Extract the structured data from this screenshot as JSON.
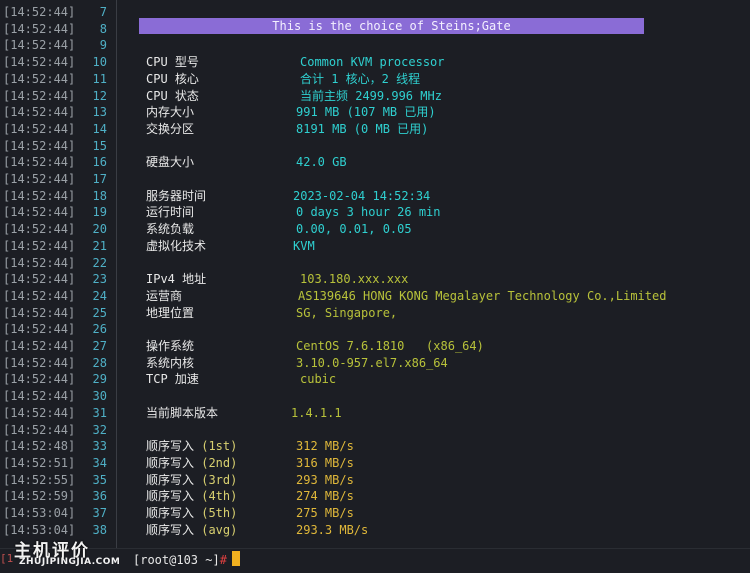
{
  "banner": "This is the choice of Steins;Gate",
  "rows": [
    {
      "ts": "[14:52:44]",
      "ln": "7",
      "label": "",
      "value": "",
      "color": ""
    },
    {
      "ts": "[14:52:44]",
      "ln": "8",
      "label": "",
      "value": "",
      "color": ""
    },
    {
      "ts": "[14:52:44]",
      "ln": "9",
      "label": "",
      "value": "",
      "color": ""
    },
    {
      "ts": "[14:52:44]",
      "ln": "10",
      "label": "CPU 型号",
      "value": "Common KVM processor",
      "color": "cyan",
      "vx": 300
    },
    {
      "ts": "[14:52:44]",
      "ln": "11",
      "label": "CPU 核心",
      "value": "合计 1 核心，2 线程",
      "color": "cyan",
      "vx": 300
    },
    {
      "ts": "[14:52:44]",
      "ln": "12",
      "label": "CPU 状态",
      "value": "当前主频 2499.996 MHz",
      "color": "cyan",
      "vx": 300
    },
    {
      "ts": "[14:52:44]",
      "ln": "13",
      "label": "内存大小",
      "value": "991 MB (107 MB 已用)",
      "color": "cyan",
      "vx": 296
    },
    {
      "ts": "[14:52:44]",
      "ln": "14",
      "label": "交换分区",
      "value": "8191 MB (0 MB 已用)",
      "color": "cyan",
      "vx": 296
    },
    {
      "ts": "[14:52:44]",
      "ln": "15",
      "label": "",
      "value": "",
      "color": ""
    },
    {
      "ts": "[14:52:44]",
      "ln": "16",
      "label": "硬盘大小",
      "value": "42.0 GB",
      "color": "cyan",
      "vx": 296
    },
    {
      "ts": "[14:52:44]",
      "ln": "17",
      "label": "",
      "value": "",
      "color": ""
    },
    {
      "ts": "[14:52:44]",
      "ln": "18",
      "label": "服务器时间",
      "value": "2023-02-04 14:52:34",
      "color": "cyan",
      "vx": 293
    },
    {
      "ts": "[14:52:44]",
      "ln": "19",
      "label": "运行时间",
      "value": "0 days 3 hour 26 min",
      "color": "cyan",
      "vx": 296
    },
    {
      "ts": "[14:52:44]",
      "ln": "20",
      "label": "系统负载",
      "value": "0.00, 0.01, 0.05",
      "color": "cyan",
      "vx": 296
    },
    {
      "ts": "[14:52:44]",
      "ln": "21",
      "label": "虚拟化技术",
      "value": "KVM",
      "color": "cyan",
      "vx": 293
    },
    {
      "ts": "[14:52:44]",
      "ln": "22",
      "label": "",
      "value": "",
      "color": ""
    },
    {
      "ts": "[14:52:44]",
      "ln": "23",
      "label": "IPv4 地址",
      "value": "103.180.xxx.xxx",
      "color": "green",
      "vx": 300
    },
    {
      "ts": "[14:52:44]",
      "ln": "24",
      "label": "运营商",
      "value": "AS139646 HONG KONG Megalayer Technology Co.,Limited",
      "color": "green",
      "vx": 298
    },
    {
      "ts": "[14:52:44]",
      "ln": "25",
      "label": "地理位置",
      "value": "SG, Singapore,",
      "color": "green",
      "vx": 296
    },
    {
      "ts": "[14:52:44]",
      "ln": "26",
      "label": "",
      "value": "",
      "color": ""
    },
    {
      "ts": "[14:52:44]",
      "ln": "27",
      "label": "操作系统",
      "value": "CentOS 7.6.1810   (x86_64)",
      "color": "green",
      "vx": 296
    },
    {
      "ts": "[14:52:44]",
      "ln": "28",
      "label": "系统内核",
      "value": "3.10.0-957.el7.x86_64",
      "color": "green",
      "vx": 296
    },
    {
      "ts": "[14:52:44]",
      "ln": "29",
      "label": "TCP 加速",
      "value": "cubic",
      "color": "green",
      "vx": 300
    },
    {
      "ts": "[14:52:44]",
      "ln": "30",
      "label": "",
      "value": "",
      "color": ""
    },
    {
      "ts": "[14:52:44]",
      "ln": "31",
      "label": "当前脚本版本",
      "value": "1.4.1.1",
      "color": "green",
      "vx": 291
    },
    {
      "ts": "[14:52:44]",
      "ln": "32",
      "label": "",
      "value": "",
      "color": ""
    },
    {
      "ts": "[14:52:48]",
      "ln": "33",
      "label": "顺序写入 (1st)",
      "value": "312 MB/s",
      "color": "yellow",
      "vx": 296
    },
    {
      "ts": "[14:52:51]",
      "ln": "34",
      "label": "顺序写入 (2nd)",
      "value": "316 MB/s",
      "color": "yellow",
      "vx": 296
    },
    {
      "ts": "[14:52:55]",
      "ln": "35",
      "label": "顺序写入 (3rd)",
      "value": "293 MB/s",
      "color": "yellow",
      "vx": 296
    },
    {
      "ts": "[14:52:59]",
      "ln": "36",
      "label": "顺序写入 (4th)",
      "value": "274 MB/s",
      "color": "yellow",
      "vx": 296
    },
    {
      "ts": "[14:53:04]",
      "ln": "37",
      "label": "顺序写入 (5th)",
      "value": "275 MB/s",
      "color": "yellow",
      "vx": 296
    },
    {
      "ts": "[14:53:04]",
      "ln": "38",
      "label": "顺序写入 (avg)",
      "value": "293.3 MB/s",
      "color": "yellow",
      "vx": 296
    }
  ],
  "statusbar": {
    "prompt": "[root@103 ~]",
    "hash": "#",
    "pane_mark": "[1",
    "watermark_cn": "主机评价",
    "watermark_en": "ZHUJIPINGJIA.COM"
  },
  "colors": {
    "background": "#1c1e24",
    "banner": "#8a6cd6",
    "cyan": "#2fd0d0",
    "green": "#b8c23a",
    "yellow": "#e0b83a",
    "cursor": "#f0b020"
  }
}
